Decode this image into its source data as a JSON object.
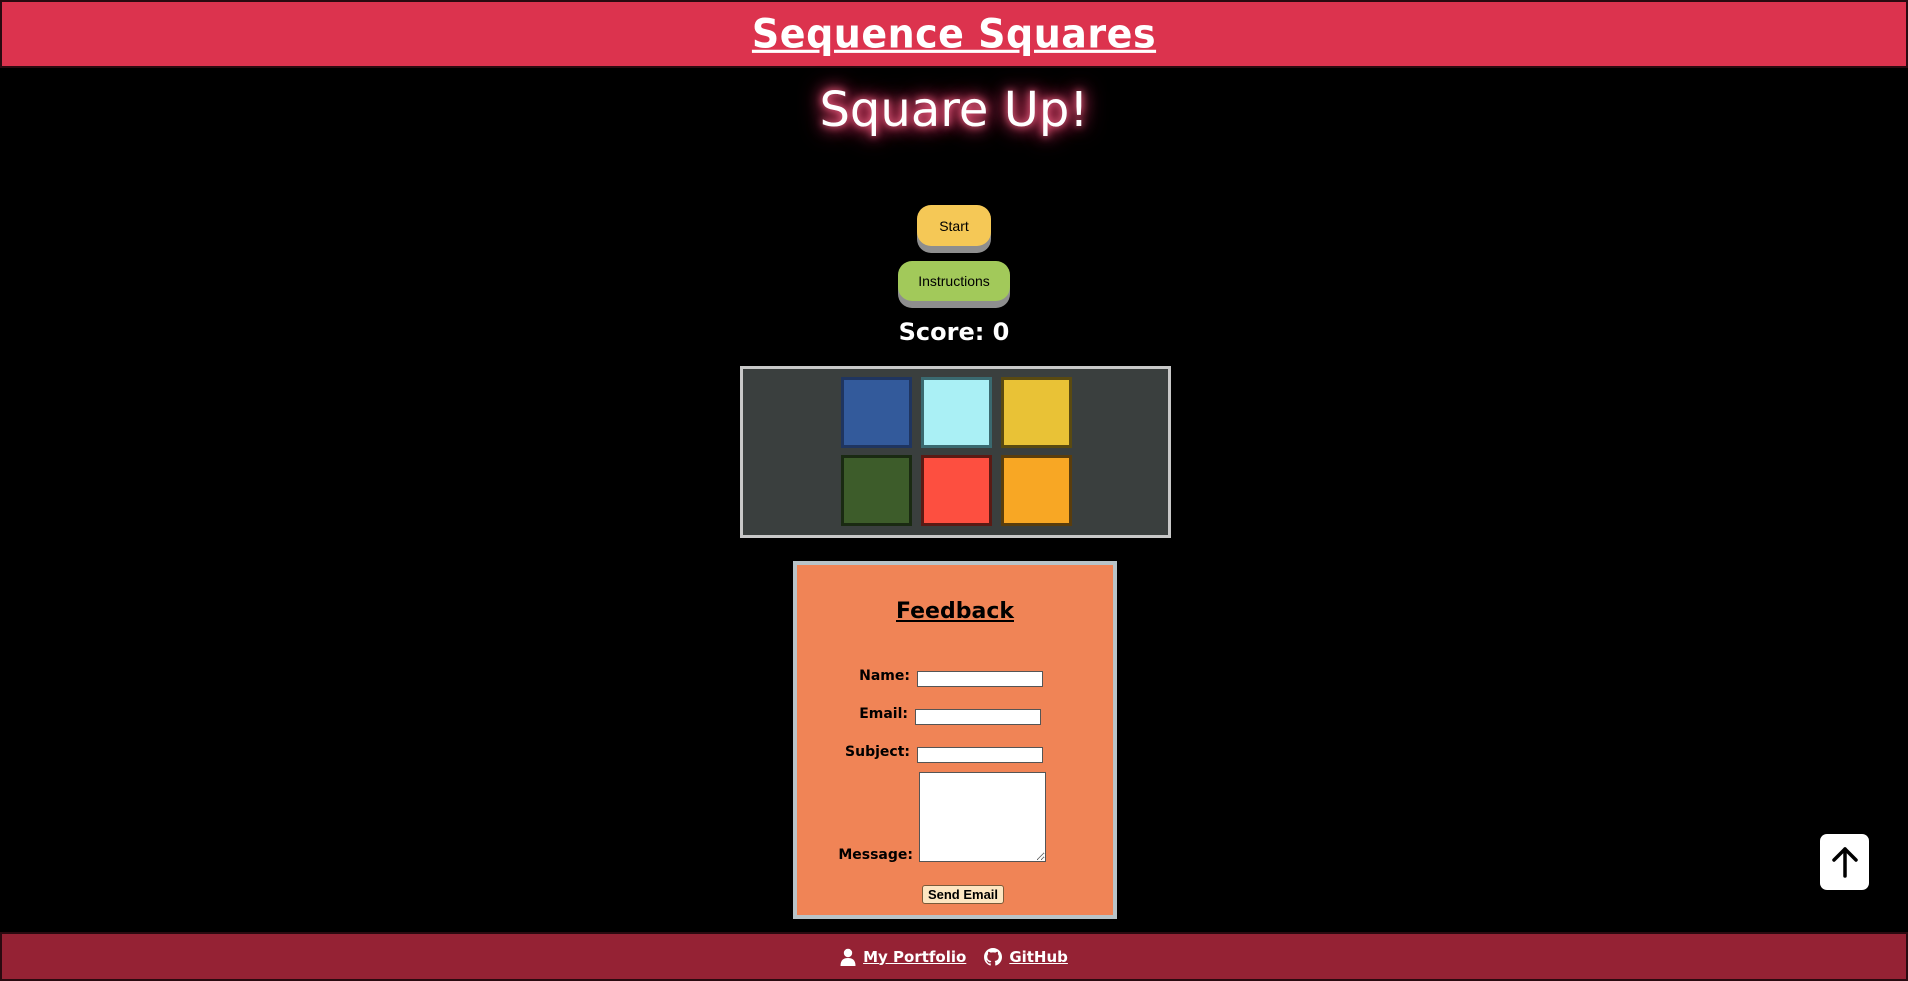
{
  "header": {
    "title": "Sequence Squares"
  },
  "main": {
    "title": "Square Up!",
    "start_label": "Start",
    "instructions_label": "Instructions",
    "score_text": "Score: 0"
  },
  "board": {
    "squares": [
      {
        "color": "#335a9b",
        "border": "#1f3560"
      },
      {
        "color": "#aaf0f5",
        "border": "#3a6a70"
      },
      {
        "color": "#e9c236",
        "border": "#5a4a10"
      },
      {
        "color": "#3d5c2a",
        "border": "#1a2a12"
      },
      {
        "color": "#fd4f40",
        "border": "#5a1a14"
      },
      {
        "color": "#f8a724",
        "border": "#5a3d0c"
      }
    ]
  },
  "feedback": {
    "title": "Feedback",
    "name_label": "Name:",
    "email_label": "Email:",
    "subject_label": "Subject:",
    "message_label": "Message:",
    "name_value": "",
    "email_value": "",
    "subject_value": "",
    "message_value": "",
    "send_label": "Send Email"
  },
  "footer": {
    "portfolio_label": "My Portfolio",
    "github_label": "GitHub",
    "portfolio_icon": "user-icon",
    "github_icon": "github-icon"
  },
  "back_to_top_icon": "arrow-up-icon"
}
